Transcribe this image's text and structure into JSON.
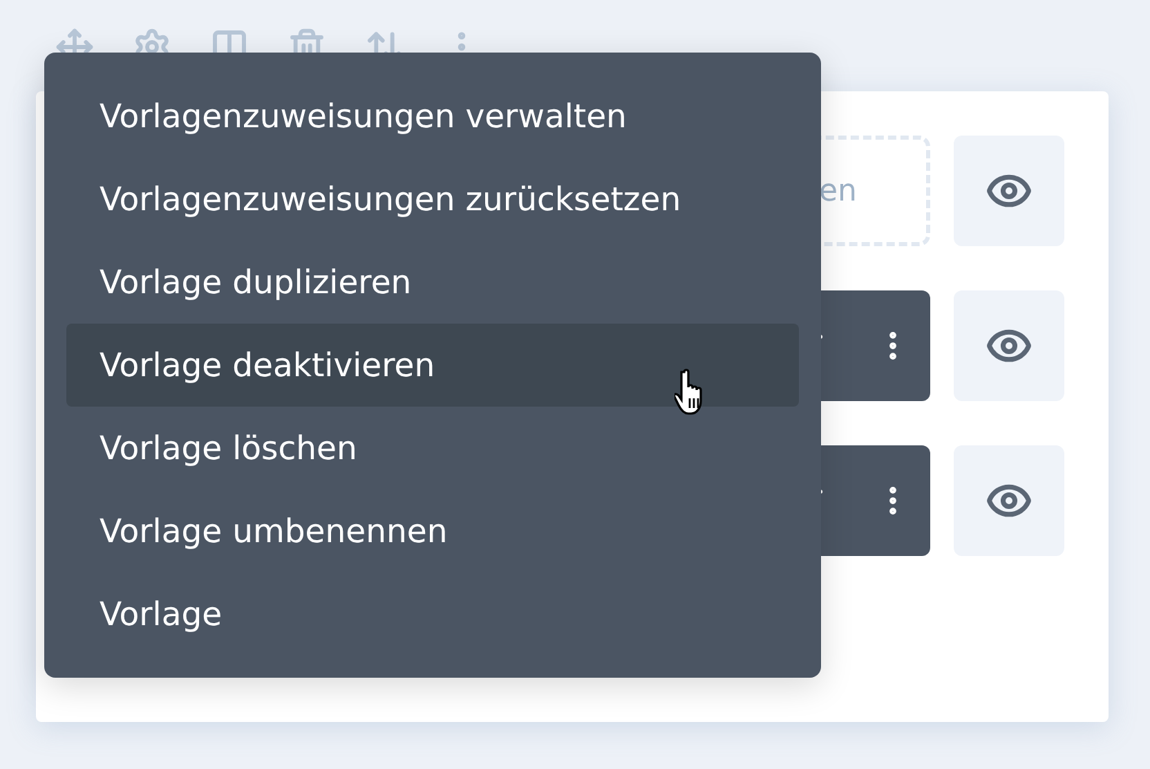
{
  "rows": [
    {
      "kind": "placeholder",
      "text": "en"
    },
    {
      "kind": "actions"
    },
    {
      "kind": "actions"
    }
  ],
  "menu": {
    "items": [
      {
        "label": "Vorlagenzuweisungen verwalten",
        "hovered": false
      },
      {
        "label": "Vorlagenzuweisungen zurücksetzen",
        "hovered": false
      },
      {
        "label": "Vorlage duplizieren",
        "hovered": false
      },
      {
        "label": "Vorlage deaktivieren",
        "hovered": true
      },
      {
        "label": "Vorlage löschen",
        "hovered": false
      },
      {
        "label": "Vorlage umbenennen",
        "hovered": false
      },
      {
        "label": "Vorlage",
        "hovered": false
      }
    ]
  }
}
